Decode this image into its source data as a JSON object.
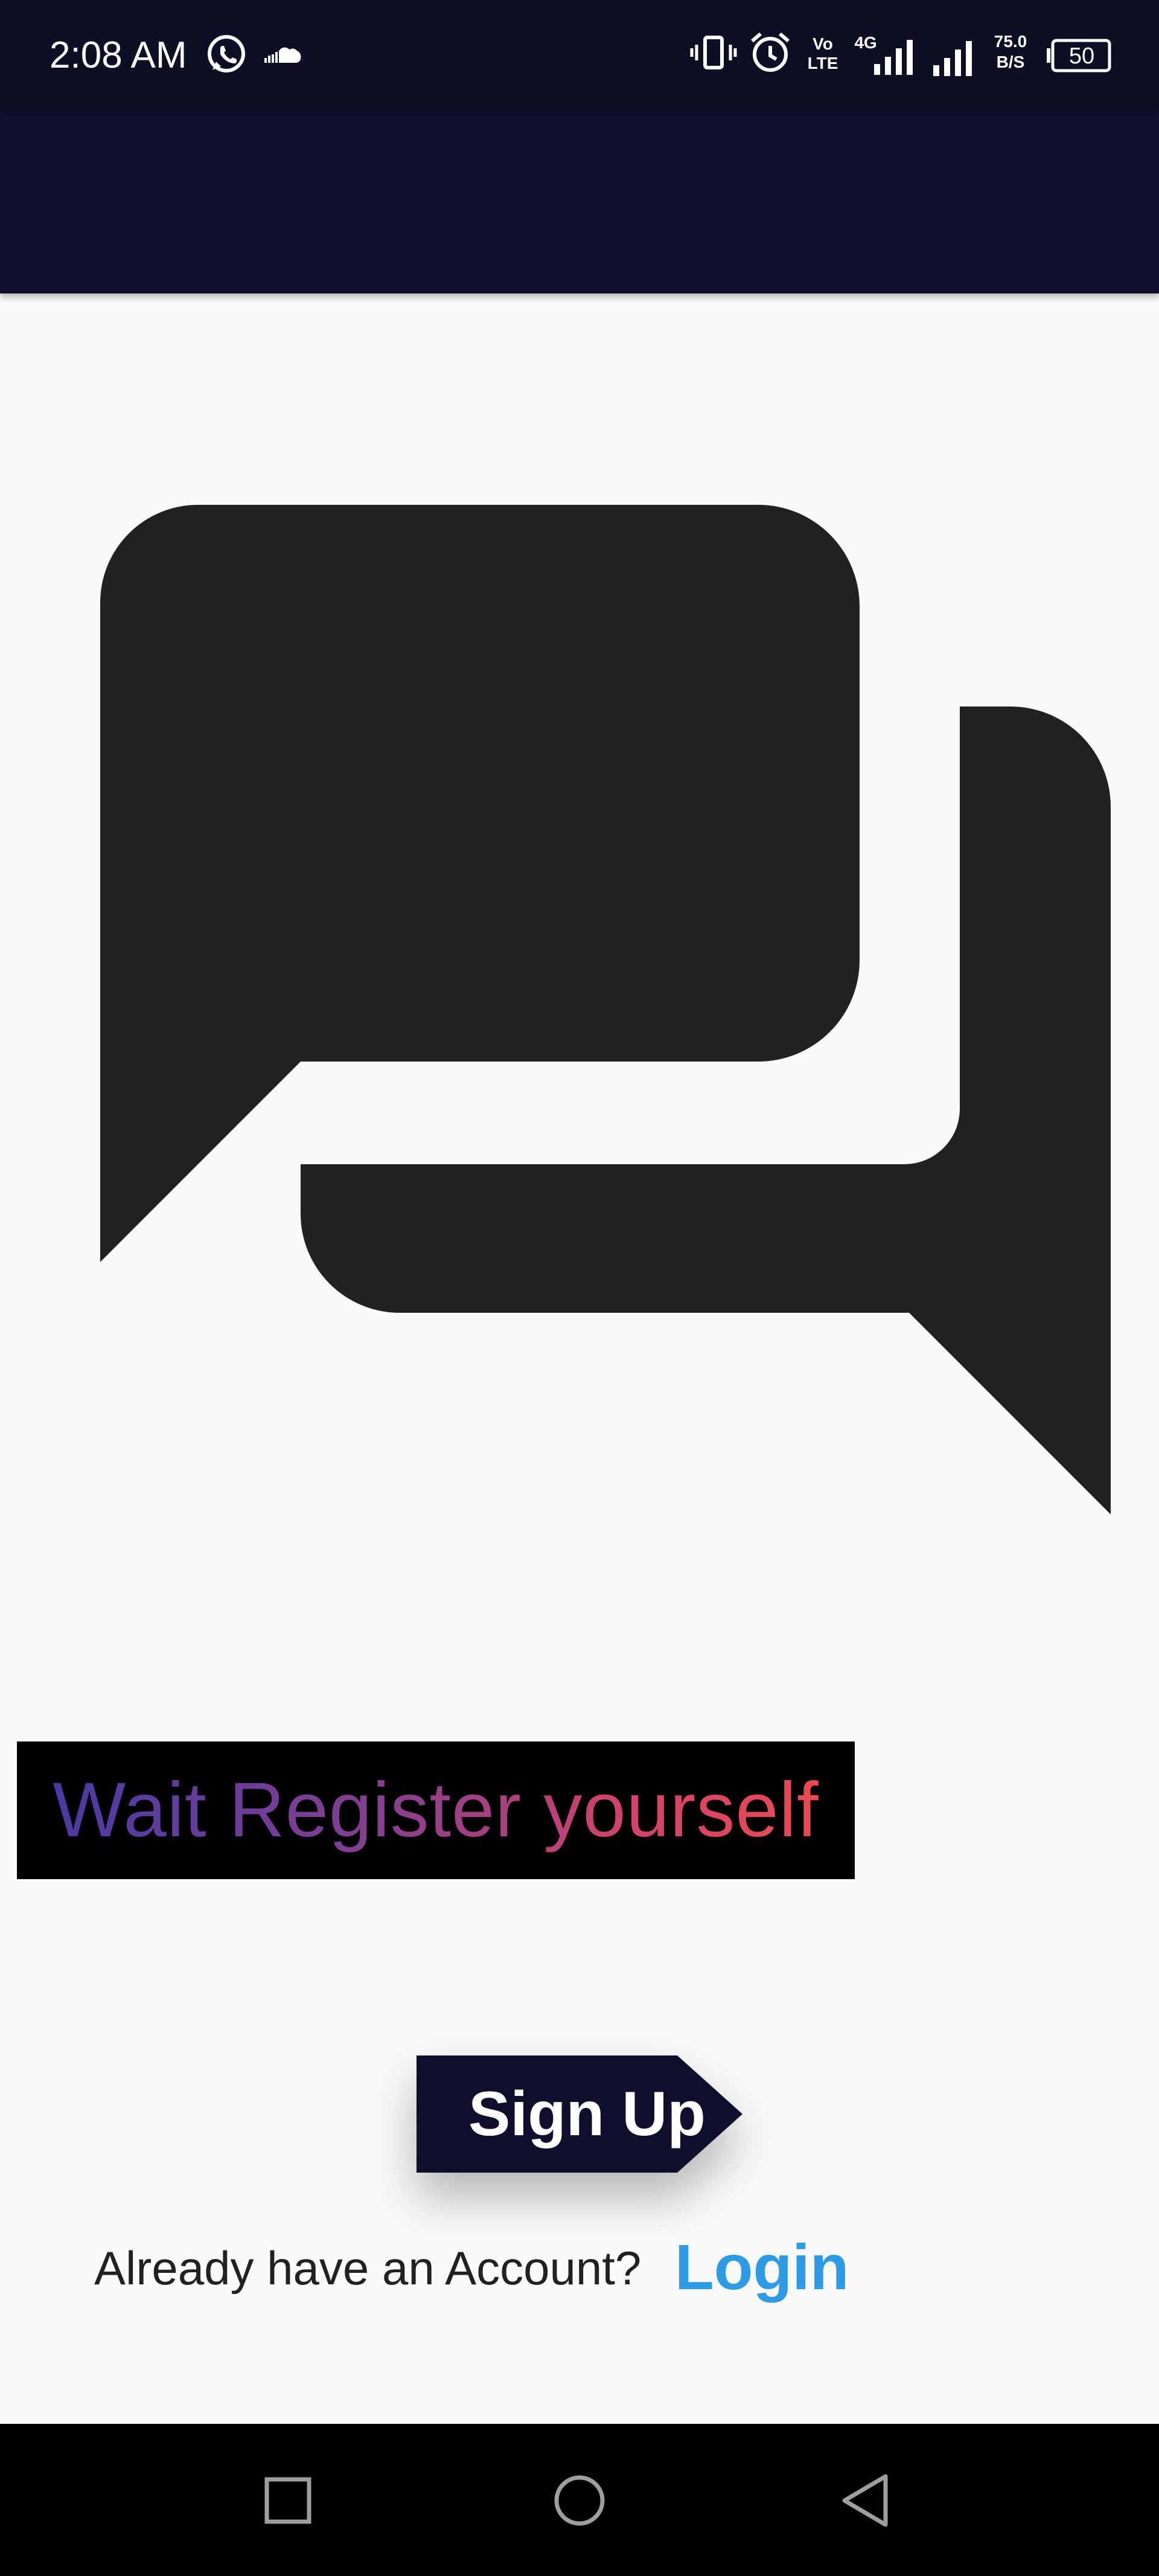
{
  "status_bar": {
    "time": "2:08 AM",
    "left_icons": [
      "whatsapp-icon",
      "cloud-icon"
    ],
    "right_icons": [
      "vibrate-icon",
      "alarm-icon",
      "volte-icon",
      "signal-4g-icon",
      "signal-icon",
      "network-speed",
      "battery-icon"
    ],
    "volte_label_top": "Vo",
    "volte_label_bottom": "LTE",
    "network_label": "4G",
    "speed_value": "75.0",
    "speed_unit": "B/S",
    "battery_level": "50"
  },
  "app_bar": {
    "color": "#0f0f2d"
  },
  "logo": {
    "icon": "chat-bubbles-icon",
    "color": "#212121"
  },
  "title": {
    "text": "Wait Register yourself",
    "gradient": [
      "#4a3aa2",
      "#8a3f8e",
      "#d1426c",
      "#e84b4f"
    ],
    "background": "#000000"
  },
  "signup": {
    "label": "Sign Up",
    "color": "#0f0f2d"
  },
  "login_prompt": {
    "text": "Already have an Account?",
    "link_label": "Login",
    "link_color": "#2d9be6"
  },
  "nav_bar": {
    "buttons": [
      "recent-apps-icon",
      "home-icon",
      "back-icon"
    ]
  }
}
